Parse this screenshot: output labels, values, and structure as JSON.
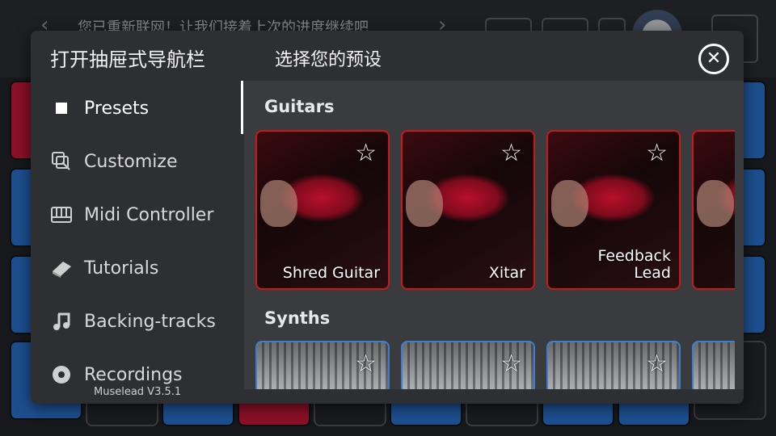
{
  "background": {
    "banner_text": "您已重新联网！让我们接着上次的进度继续吧",
    "nav_left": "‹",
    "nav_right": "›",
    "colors": {
      "pad_blue": "#1d4f8f",
      "pad_red": "#8b1028",
      "pad_dark": "#1a1b1e"
    }
  },
  "drawer": {
    "title": "打开抽屉式导航栏",
    "preset_title": "选择您的预设",
    "close_icon": "close-circle-icon",
    "version": "Muselead V3.5.1",
    "items": [
      {
        "label": "Presets",
        "icon": "square-icon",
        "active": true
      },
      {
        "label": "Customize",
        "icon": "customize-icon",
        "active": false
      },
      {
        "label": "Midi Controller",
        "icon": "keyboard-icon",
        "active": false
      },
      {
        "label": "Tutorials",
        "icon": "book-icon",
        "active": false
      },
      {
        "label": "Backing-tracks",
        "icon": "music-note-icon",
        "active": false
      },
      {
        "label": "Recordings",
        "icon": "record-icon",
        "active": false
      }
    ]
  },
  "presets": {
    "sections": [
      {
        "title": "Guitars",
        "accent": "#c81a1a",
        "cards": [
          {
            "label": "Shred Guitar"
          },
          {
            "label": "Xitar"
          },
          {
            "label": "Feedback\nLead"
          },
          {
            "label": ""
          }
        ]
      },
      {
        "title": "Synths",
        "accent": "#3b7fcf",
        "cards": [
          {
            "label": ""
          },
          {
            "label": ""
          },
          {
            "label": ""
          },
          {
            "label": ""
          }
        ]
      }
    ],
    "favorite_icon": "☆"
  }
}
